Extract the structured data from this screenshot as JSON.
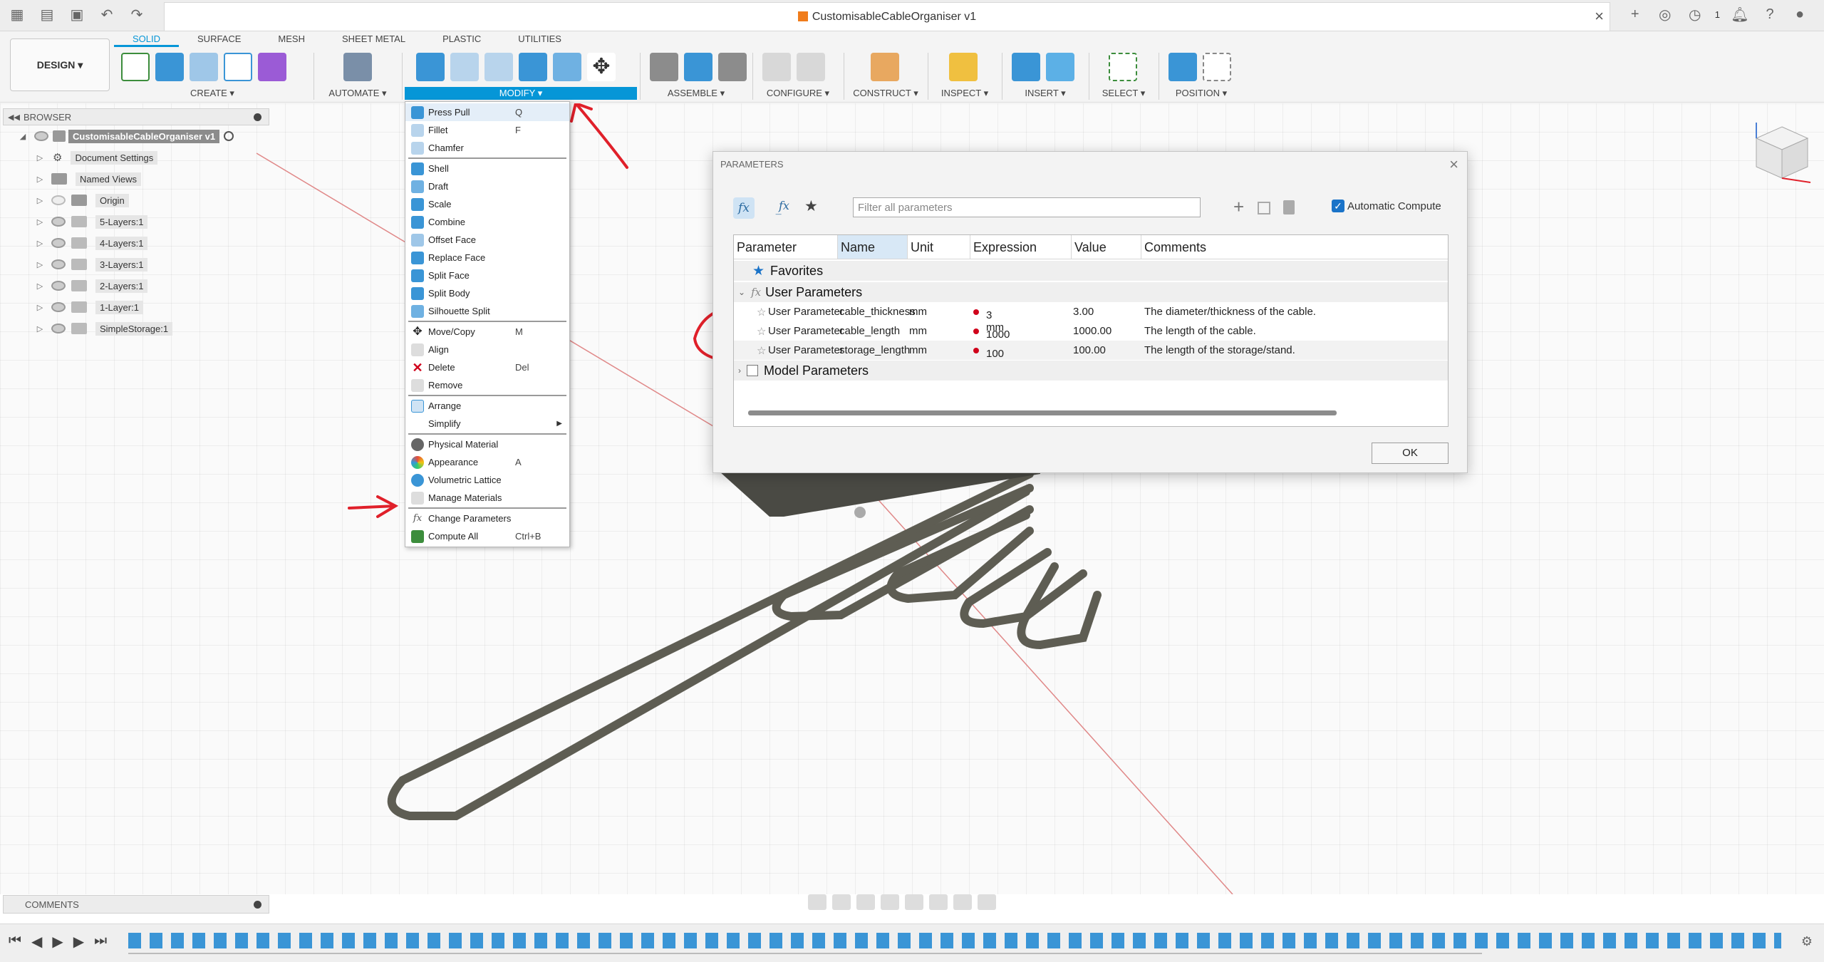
{
  "app": {
    "title": "CustomisableCableOrganiser v1",
    "workspace_button": "DESIGN ▾",
    "notifications_count": "1"
  },
  "tabs": [
    "SOLID",
    "SURFACE",
    "MESH",
    "SHEET METAL",
    "PLASTIC",
    "UTILITIES"
  ],
  "active_tab": "SOLID",
  "groups": {
    "create": "CREATE ▾",
    "automate": "AUTOMATE ▾",
    "modify": "MODIFY ▾",
    "assemble": "ASSEMBLE ▾",
    "configure": "CONFIGURE ▾",
    "construct": "CONSTRUCT ▾",
    "inspect": "INSPECT ▾",
    "insert": "INSERT ▾",
    "select": "SELECT ▾",
    "position": "POSITION ▾"
  },
  "browser": {
    "title": "BROWSER",
    "root": "CustomisableCableOrganiser v1",
    "items": [
      "Document Settings",
      "Named Views",
      "Origin",
      "5-Layers:1",
      "4-Layers:1",
      "3-Layers:1",
      "2-Layers:1",
      "1-Layer:1",
      "SimpleStorage:1"
    ]
  },
  "comments": "COMMENTS",
  "modify_menu": {
    "items": [
      {
        "label": "Press Pull",
        "shortcut": "Q"
      },
      {
        "label": "Fillet",
        "shortcut": "F"
      },
      {
        "label": "Chamfer",
        "shortcut": ""
      },
      {
        "label": "Shell",
        "shortcut": ""
      },
      {
        "label": "Draft",
        "shortcut": ""
      },
      {
        "label": "Scale",
        "shortcut": ""
      },
      {
        "label": "Combine",
        "shortcut": ""
      },
      {
        "label": "Offset Face",
        "shortcut": ""
      },
      {
        "label": "Replace Face",
        "shortcut": ""
      },
      {
        "label": "Split Face",
        "shortcut": ""
      },
      {
        "label": "Split Body",
        "shortcut": ""
      },
      {
        "label": "Silhouette Split",
        "shortcut": ""
      },
      {
        "label": "Move/Copy",
        "shortcut": "M"
      },
      {
        "label": "Align",
        "shortcut": ""
      },
      {
        "label": "Delete",
        "shortcut": "Del"
      },
      {
        "label": "Remove",
        "shortcut": ""
      },
      {
        "label": "Arrange",
        "shortcut": ""
      },
      {
        "label": "Simplify",
        "shortcut": ""
      },
      {
        "label": "Physical Material",
        "shortcut": ""
      },
      {
        "label": "Appearance",
        "shortcut": "A"
      },
      {
        "label": "Volumetric Lattice",
        "shortcut": ""
      },
      {
        "label": "Manage Materials",
        "shortcut": ""
      },
      {
        "label": "Change Parameters",
        "shortcut": ""
      },
      {
        "label": "Compute All",
        "shortcut": "Ctrl+B"
      }
    ]
  },
  "parameters_dialog": {
    "title": "PARAMETERS",
    "filter_placeholder": "Filter all parameters",
    "auto_compute": "Automatic Compute",
    "columns": [
      "Parameter",
      "Name",
      "Unit",
      "Expression",
      "Value",
      "Comments"
    ],
    "favorites": "Favorites",
    "user_params_header": "User Parameters",
    "model_params_header": "Model Parameters",
    "rows": [
      {
        "parameter": "User Parameter",
        "name": "cable_thickness",
        "unit": "mm",
        "expression": "3 mm",
        "value": "3.00",
        "comment": "The diameter/thickness of the cable."
      },
      {
        "parameter": "User Parameter",
        "name": "cable_length",
        "unit": "mm",
        "expression": "1000 mm",
        "value": "1000.00",
        "comment": "The length of the cable."
      },
      {
        "parameter": "User Parameter",
        "name": "storage_length",
        "unit": "mm",
        "expression": "100 mm",
        "value": "100.00",
        "comment": "The length of the storage/stand."
      }
    ],
    "ok": "OK"
  },
  "colors": {
    "accent": "#0696d7",
    "annotation": "#e0202a",
    "model": "#5e5d53"
  }
}
